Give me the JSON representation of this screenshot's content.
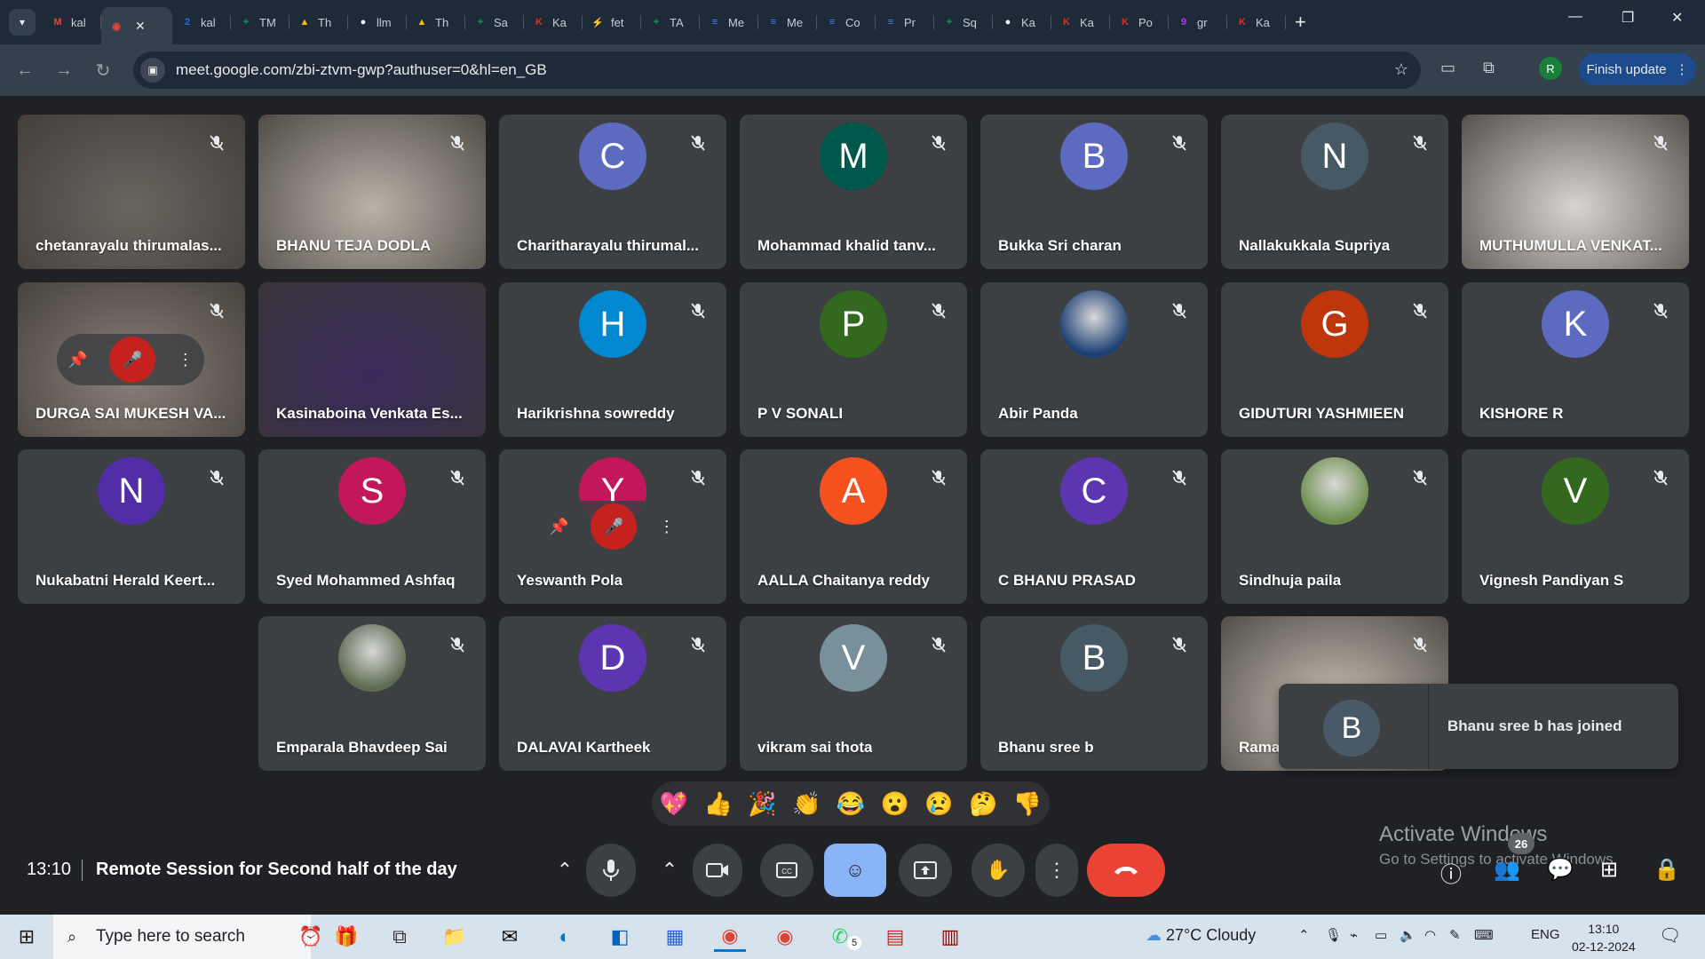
{
  "browser": {
    "tabs": [
      {
        "label": "kal",
        "color": "#ea4335",
        "glyph": "M"
      },
      {
        "label": "",
        "color": "#ea4335",
        "glyph": "◉",
        "active": true
      },
      {
        "label": "kal",
        "color": "#1a73e8",
        "glyph": "2"
      },
      {
        "label": "TM",
        "color": "#0f9d58",
        "glyph": "+"
      },
      {
        "label": "Th",
        "color": "#fbbc04",
        "glyph": "▲"
      },
      {
        "label": "llm",
        "color": "#ffffff",
        "glyph": "●"
      },
      {
        "label": "Th",
        "color": "#fbbc04",
        "glyph": "▲"
      },
      {
        "label": "Sa",
        "color": "#0f9d58",
        "glyph": "+"
      },
      {
        "label": "Ka",
        "color": "#d93025",
        "glyph": "K"
      },
      {
        "label": "fet",
        "color": "#1a73e8",
        "glyph": "⚡"
      },
      {
        "label": "TA",
        "color": "#0f9d58",
        "glyph": "+"
      },
      {
        "label": "Me",
        "color": "#4285f4",
        "glyph": "≡"
      },
      {
        "label": "Me",
        "color": "#4285f4",
        "glyph": "≡"
      },
      {
        "label": "Co",
        "color": "#4285f4",
        "glyph": "≡"
      },
      {
        "label": "Pr",
        "color": "#4285f4",
        "glyph": "≡"
      },
      {
        "label": "Sq",
        "color": "#0f9d58",
        "glyph": "+"
      },
      {
        "label": "Ka",
        "color": "#ffffff",
        "glyph": "●"
      },
      {
        "label": "Ka",
        "color": "#d93025",
        "glyph": "K"
      },
      {
        "label": "Po",
        "color": "#d93025",
        "glyph": "K"
      },
      {
        "label": "gr",
        "color": "#a142f4",
        "glyph": "9"
      },
      {
        "label": "Ka",
        "color": "#d93025",
        "glyph": "K"
      }
    ],
    "url": "meet.google.com/zbi-ztvm-gwp?authuser=0&hl=en_GB",
    "profile_initial": "R",
    "finish_update": "Finish update"
  },
  "participants": [
    {
      "name": "chetanrayalu thirumalas...",
      "type": "video",
      "bg": "#6b6560"
    },
    {
      "name": "BHANU TEJA DODLA",
      "type": "video",
      "bg": "#b9b2a8"
    },
    {
      "name": "Charitharayalu thirumal...",
      "type": "avatar",
      "initial": "C",
      "color": "#5c6bc0"
    },
    {
      "name": "Mohammad khalid tanv...",
      "type": "avatar",
      "initial": "M",
      "color": "#00574b"
    },
    {
      "name": "Bukka Sri charan",
      "type": "avatar",
      "initial": "B",
      "color": "#5c6bc0"
    },
    {
      "name": "Nallakukkala Supriya",
      "type": "avatar",
      "initial": "N",
      "color": "#455a64"
    },
    {
      "name": "MUTHUMULLA VENKAT...",
      "type": "video",
      "bg": "#d8d4d0"
    },
    {
      "name": "DURGA SAI MUKESH VA...",
      "type": "video",
      "bg": "#8a8078",
      "hover": true
    },
    {
      "name": "Kasinaboina Venkata Es...",
      "type": "video",
      "bg": "#3a2a5c"
    },
    {
      "name": "Harikrishna sowreddy",
      "type": "avatar",
      "initial": "H",
      "color": "#0288d1"
    },
    {
      "name": "P V SONALI",
      "type": "avatar",
      "initial": "P",
      "color": "#33691e"
    },
    {
      "name": "Abir Panda",
      "type": "photo",
      "color": "#1c3f74"
    },
    {
      "name": "GIDUTURI YASHMIEEN",
      "type": "avatar",
      "initial": "G",
      "color": "#bf360c"
    },
    {
      "name": "KISHORE R",
      "type": "avatar",
      "initial": "K",
      "color": "#5c6bc0"
    },
    {
      "name": "Nukabatni Herald Keert...",
      "type": "avatar",
      "initial": "N",
      "color": "#512da8"
    },
    {
      "name": "Syed Mohammed Ashfaq",
      "type": "avatar",
      "initial": "S",
      "color": "#c2185b"
    },
    {
      "name": "Yeswanth Pola",
      "type": "avatar",
      "initial": "Y",
      "color": "#c2185b",
      "hover": true
    },
    {
      "name": "AALLA Chaitanya reddy",
      "type": "avatar",
      "initial": "A",
      "color": "#f4511e"
    },
    {
      "name": "C BHANU PRASAD",
      "type": "avatar",
      "initial": "C",
      "color": "#5e35b1"
    },
    {
      "name": "Sindhuja paila",
      "type": "photo",
      "color": "#6d8f4e"
    },
    {
      "name": "Vignesh Pandiyan S",
      "type": "avatar",
      "initial": "V",
      "color": "#33691e"
    },
    {
      "name": "Emparala Bhavdeep Sai",
      "type": "photo",
      "color": "#5d6b52"
    },
    {
      "name": "DALAVAI Kartheek",
      "type": "avatar",
      "initial": "D",
      "color": "#5e35b1"
    },
    {
      "name": "vikram sai thota",
      "type": "avatar",
      "initial": "V",
      "color": "#78909c"
    },
    {
      "name": "Bhanu sree b",
      "type": "avatar",
      "initial": "B",
      "color": "#455a64"
    },
    {
      "name": "Rama",
      "type": "video",
      "bg": "#c9c2b6"
    }
  ],
  "toast": {
    "initial": "B",
    "message": "Bhanu sree b has joined"
  },
  "reactions": [
    "💖",
    "👍",
    "🎉",
    "👏",
    "😂",
    "😮",
    "😢",
    "🤔",
    "👎"
  ],
  "meeting": {
    "time": "13:10",
    "title": "Remote Session for Second half of the day"
  },
  "people_count": "26",
  "watermark": {
    "line1": "Activate Windows",
    "line2": "Go to Settings to activate Windows."
  },
  "taskbar": {
    "search_placeholder": "Type here to search",
    "weather": "27°C  Cloudy",
    "lang": "ENG",
    "time": "13:10",
    "date": "02-12-2024",
    "whatsapp_badge": "5"
  }
}
